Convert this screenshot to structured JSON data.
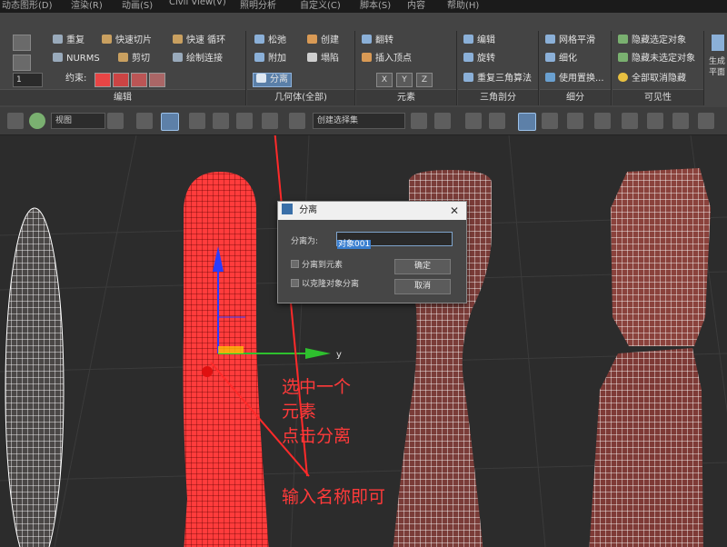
{
  "menubar": {
    "items": [
      "动态图形(D)",
      "渲染(R)",
      "动画(S)",
      "Civil View(V)",
      "照明分析",
      "自定义(C)",
      "脚本(S)",
      "内容",
      "帮助(H)"
    ]
  },
  "ribbon": {
    "spinner_value": "1",
    "edit_group": {
      "repeat": "重复",
      "fast_slice": "快速切片",
      "fast_loop": "快速 循环",
      "nurms": "NURMS",
      "cut": "剪切",
      "paint_connect": "绘制连接",
      "constraint": "约束:",
      "title": "编辑"
    },
    "geometry_group": {
      "relax": "松弛",
      "create": "创建",
      "attach": "附加",
      "collapse": "塌陷",
      "detach": "分离",
      "title": "几何体(全部)"
    },
    "element_group": {
      "flip": "翻转",
      "insert_vertex": "插入顶点",
      "title": "元素"
    },
    "tri_group": {
      "edit": "编辑",
      "rotate": "旋转",
      "retriangulate": "重复三角算法",
      "title": "三角剖分"
    },
    "subdiv_group": {
      "smooth": "网格平滑",
      "refine": "细化",
      "use_displace": "使用置换...",
      "title": "细分"
    },
    "vis_group": {
      "hide_sel": "隐藏选定对象",
      "hide_unsel": "隐藏未选定对象",
      "unhide": "全部取消隐藏",
      "title": "可见性"
    },
    "extra": "生成\n平面"
  },
  "toolbar": {
    "view_dropdown": "视图",
    "selset_dropdown": "创建选择集"
  },
  "dialog": {
    "title": "分离",
    "name_label": "分离为:",
    "name_value": "对象001",
    "detach_element": "分离到元素",
    "clone_detach": "以克隆对象分离",
    "ok": "确定",
    "cancel": "取消"
  },
  "viewport": {
    "axis_y": "y"
  },
  "annotations": {
    "line1": "选中一个",
    "line2": "元素",
    "line3": "点击分离",
    "line4": "输入名称即可"
  },
  "colors": {
    "accent": "#5b80aa",
    "annotation": "#ff2a2a",
    "mesh_selected": "#ff3838",
    "mesh_normal": "#7e3a36"
  }
}
